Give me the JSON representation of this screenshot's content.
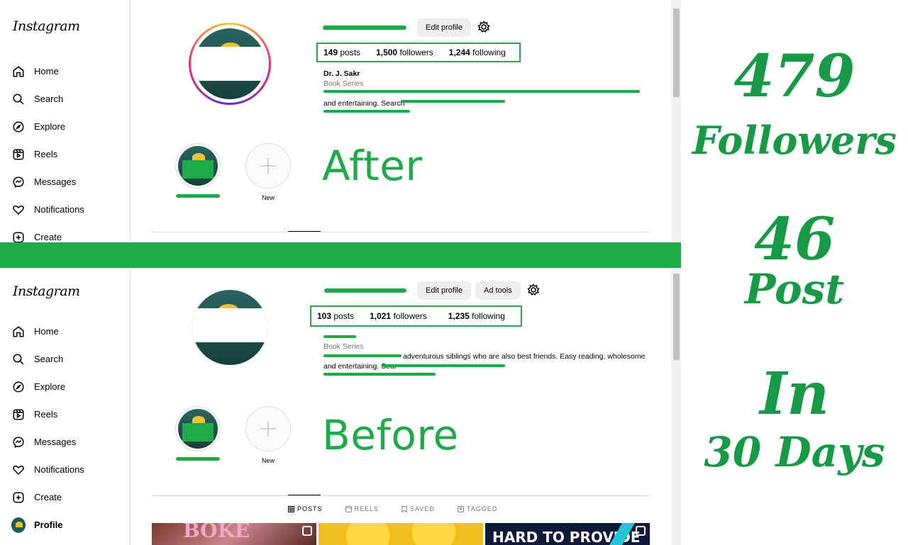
{
  "top_panel": {
    "logo": "Instagram",
    "nav": [
      {
        "name": "home",
        "label": "Home"
      },
      {
        "name": "search",
        "label": "Search"
      },
      {
        "name": "explore",
        "label": "Explore"
      },
      {
        "name": "reels",
        "label": "Reels"
      },
      {
        "name": "messages",
        "label": "Messages"
      },
      {
        "name": "notifications",
        "label": "Notifications"
      },
      {
        "name": "create",
        "label": "Create"
      }
    ],
    "edit_profile": "Edit profile",
    "stats": {
      "posts": "149",
      "posts_label": "posts",
      "followers": "1,500",
      "followers_label": "followers",
      "following": "1,244",
      "following_label": "following"
    },
    "bio": {
      "name": "Dr. J. Sakr",
      "category": "Book Series",
      "line2": "and entertaining. Search"
    },
    "highlight_new": "New",
    "label": "After"
  },
  "bottom_panel": {
    "logo": "Instagram",
    "nav": [
      {
        "name": "home",
        "label": "Home"
      },
      {
        "name": "search",
        "label": "Search"
      },
      {
        "name": "explore",
        "label": "Explore"
      },
      {
        "name": "reels",
        "label": "Reels"
      },
      {
        "name": "messages",
        "label": "Messages"
      },
      {
        "name": "notifications",
        "label": "Notifications"
      },
      {
        "name": "create",
        "label": "Create"
      },
      {
        "name": "profile",
        "label": "Profile"
      }
    ],
    "edit_profile": "Edit profile",
    "ad_tools": "Ad tools",
    "stats": {
      "posts": "103",
      "posts_label": "posts",
      "followers": "1,021",
      "followers_label": "followers",
      "following": "1,235",
      "following_label": "following"
    },
    "bio": {
      "category": "Book Series",
      "line1": "adventurous siblings who are also best friends. Easy reading, wholesome",
      "line2": "and entertaining. Sear"
    },
    "highlight_new": "New",
    "label": "Before",
    "tabs": [
      {
        "name": "posts",
        "label": "POSTS"
      },
      {
        "name": "reels",
        "label": "REELS"
      },
      {
        "name": "saved",
        "label": "SAVED"
      },
      {
        "name": "tagged",
        "label": "TAGGED"
      }
    ],
    "thumb3_text": "HARD TO PROVIDE"
  },
  "summary": {
    "followers_num": "479",
    "followers_label": "Followers",
    "post_num": "46",
    "post_label": "Post",
    "in_label": "In",
    "days_label": "30 Days"
  },
  "colors": {
    "accent_green": "#1faa4a",
    "headline_green": "#179a45"
  }
}
